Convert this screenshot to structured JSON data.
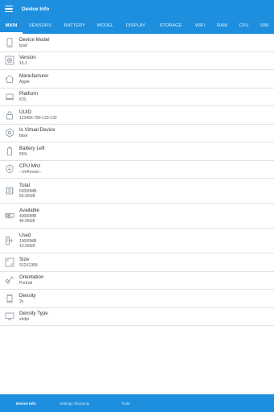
{
  "appbar": {
    "title": "Device Info",
    "menu_icon": "hamburger-menu-icon"
  },
  "tabs": [
    "MAIN",
    "SENSORS",
    "BATTERY",
    "MODEL",
    "DISPLAY",
    "STORAGE",
    "WIFI",
    "RAM",
    "CPU",
    "SIM"
  ],
  "active_tab": "MAIN",
  "rows": [
    {
      "label": "Device Model",
      "values": [
        "Ipad"
      ],
      "icon": "tablet-icon"
    },
    {
      "label": "Version",
      "values": [
        "15.1"
      ],
      "icon": "version-icon"
    },
    {
      "label": "Manufacturer",
      "values": [
        "Apple"
      ],
      "icon": "house-icon"
    },
    {
      "label": "Platform",
      "values": [
        "iOS"
      ],
      "icon": "laptop-icon"
    },
    {
      "label": "UUID",
      "values": [
        "123456-789-123-132"
      ],
      "icon": "lock-icon"
    },
    {
      "label": "Is Virtual Device",
      "values": [
        "false"
      ],
      "icon": "gear-icon"
    },
    {
      "label": "Battery Left",
      "values": [
        "56%"
      ],
      "icon": "battery-icon"
    },
    {
      "label": "CPU Mhz",
      "values": [
        "- UnKnown -"
      ],
      "icon": "bolt-shield-icon"
    },
    {
      "label": "Total",
      "values": [
        "50000MB",
        "50.00GB"
      ],
      "icon": "memory-chip-icon"
    },
    {
      "label": "Available",
      "values": [
        "40000MB",
        "40.00GB"
      ],
      "icon": "ram-module-icon"
    },
    {
      "label": "Used",
      "values": [
        "10000MB",
        "10.00GB"
      ],
      "icon": "server-icon"
    },
    {
      "label": "Size",
      "values": [
        "912X1368"
      ],
      "icon": "screen-size-icon"
    },
    {
      "label": "Orientation",
      "values": [
        "Portrait"
      ],
      "icon": "rotate-icon"
    },
    {
      "label": "Density",
      "values": [
        "2x"
      ],
      "icon": "phone-icon"
    },
    {
      "label": "Density Type",
      "values": [
        "xhdpi"
      ],
      "icon": "monitor-icon"
    }
  ],
  "bottom_nav": [
    {
      "label": "Device Info",
      "active": true
    },
    {
      "label": "Settings Shortcuts",
      "active": false
    },
    {
      "label": "Tools",
      "active": false
    }
  ],
  "colors": {
    "primary": "#1e8fde",
    "divider": "#e2e2e2",
    "icon": "#8a96a3"
  }
}
